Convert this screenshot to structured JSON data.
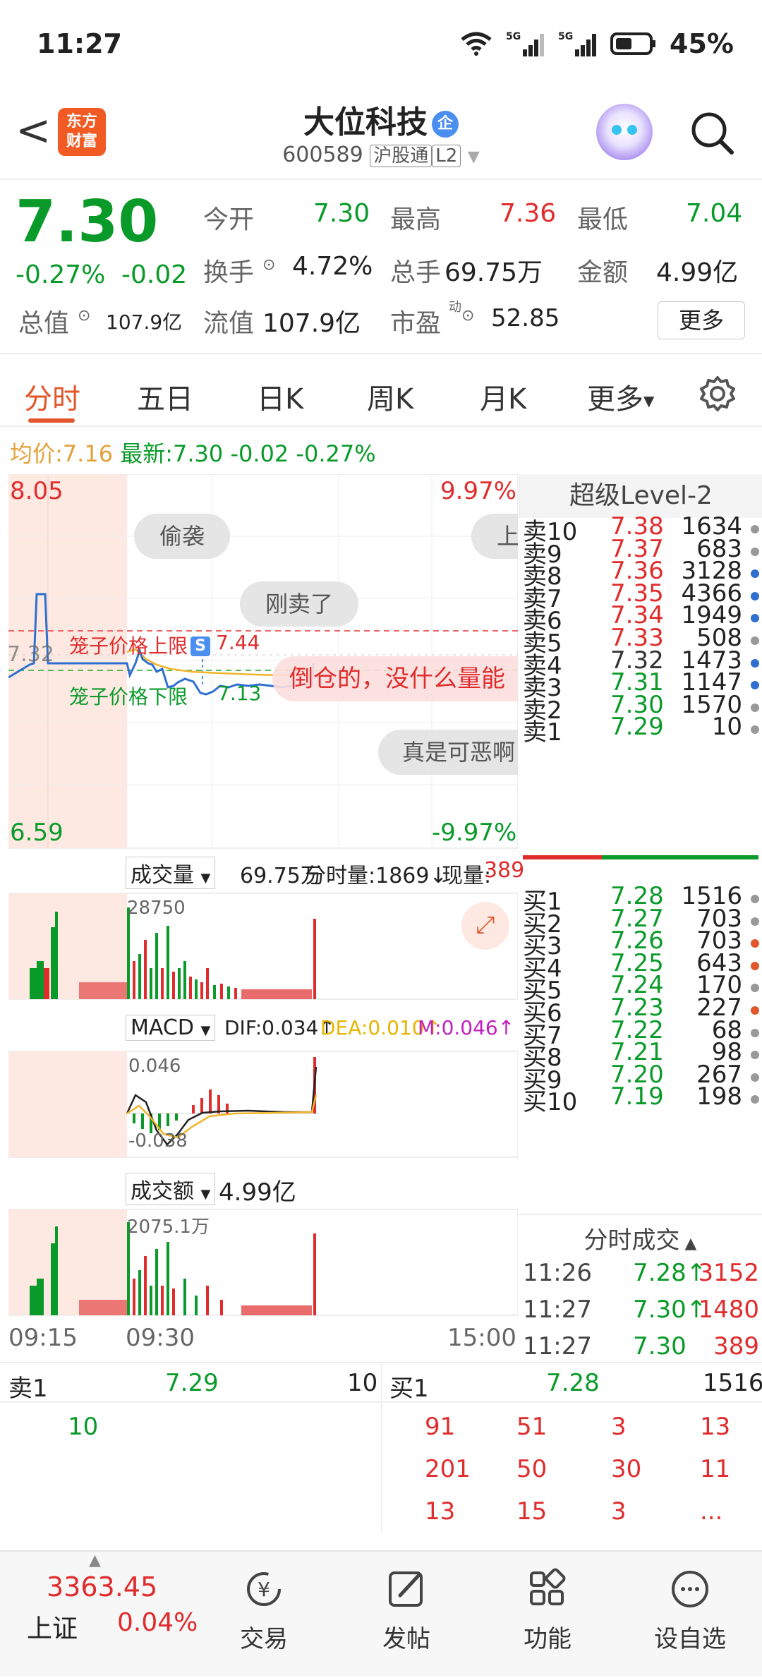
{
  "status": {
    "time": "11:27",
    "battery": "45%",
    "net1": "5G",
    "net2": "5G"
  },
  "header": {
    "back": "<",
    "logo_line1": "东方",
    "logo_line2": "财富",
    "stock_name": "大位科技",
    "badge": "企",
    "code": "600589",
    "market": "沪股通",
    "level": "L2"
  },
  "quote": {
    "price": "7.30",
    "change_pct": "-0.27%",
    "change": "-0.02",
    "open_label": "今开",
    "open": "7.30",
    "high_label": "最高",
    "high": "7.36",
    "low_label": "最低",
    "low": "7.04",
    "turnover_label": "换手",
    "turnover": "4.72%",
    "volume_label": "总手",
    "volume": "69.75万",
    "amount_label": "金额",
    "amount": "4.99亿",
    "mktcap_label": "总值",
    "mktcap": "107.9亿",
    "float_label": "流值",
    "float": "107.9亿",
    "pe_label": "市盈",
    "pe_sup": "动",
    "pe": "52.85",
    "more": "更多"
  },
  "tabs": [
    "分时",
    "五日",
    "日K",
    "周K",
    "月K",
    "更多"
  ],
  "avg": {
    "avg_label": "均价:",
    "avg": "7.16",
    "latest_label": "最新:",
    "latest": "7.30",
    "chg": "-0.02",
    "pct": "-0.27%"
  },
  "chart": {
    "top_price": "8.05",
    "top_pct": "9.97%",
    "bottom_price": "6.59",
    "bottom_pct": "-9.97%",
    "ref_price": "7.32",
    "cage_upper_label": "笼子价格上限",
    "cage_upper": "7.44",
    "cage_lower_label": "笼子价格下限",
    "cage_lower": "7.13",
    "s_marker": "S",
    "vol_sel": "成交量",
    "vol_total": "69.75万",
    "vol_min_label": "分时量:1869↓",
    "vol_now_label": "现量:",
    "vol_now": "389",
    "vol_max": "28750",
    "macd_sel": "MACD",
    "dif": "DIF:0.034↑",
    "dea": "DEA:0.010↑",
    "m": "M:0.046↑",
    "macd_max": "0.046",
    "macd_min": "-0.038",
    "amt_sel": "成交额",
    "amt_total": "4.99亿",
    "amt_max": "2075.1万",
    "t_start": "09:15",
    "t_open": "09:30",
    "t_end": "15:00"
  },
  "comments": [
    "偷袭",
    "上",
    "刚卖了",
    "倒仓的，没什么量能",
    "真是可恶啊"
  ],
  "level2_title": "超级Level-2",
  "asks": [
    {
      "name": "卖10",
      "price": "7.38",
      "vol": "1634",
      "dot": "#999999",
      "color": "red"
    },
    {
      "name": "卖9",
      "price": "7.37",
      "vol": "683",
      "dot": "#999999",
      "color": "red"
    },
    {
      "name": "卖8",
      "price": "7.36",
      "vol": "3128",
      "dot": "#2f6fd0",
      "color": "red"
    },
    {
      "name": "卖7",
      "price": "7.35",
      "vol": "4366",
      "dot": "#2f6fd0",
      "color": "red"
    },
    {
      "name": "卖6",
      "price": "7.34",
      "vol": "1949",
      "dot": "#2f6fd0",
      "color": "red"
    },
    {
      "name": "卖5",
      "price": "7.33",
      "vol": "508",
      "dot": "#999999",
      "color": "red"
    },
    {
      "name": "卖4",
      "price": "7.32",
      "vol": "1473",
      "dot": "#2f6fd0",
      "color": "gray"
    },
    {
      "name": "卖3",
      "price": "7.31",
      "vol": "1147",
      "dot": "#2f6fd0",
      "color": "green"
    },
    {
      "name": "卖2",
      "price": "7.30",
      "vol": "1570",
      "dot": "#999999",
      "color": "green"
    },
    {
      "name": "卖1",
      "price": "7.29",
      "vol": "10",
      "dot": "#999999",
      "color": "green"
    }
  ],
  "bids": [
    {
      "name": "买1",
      "price": "7.28",
      "vol": "1516",
      "dot": "#999999",
      "color": "green"
    },
    {
      "name": "买2",
      "price": "7.27",
      "vol": "703",
      "dot": "#999999",
      "color": "green"
    },
    {
      "name": "买3",
      "price": "7.26",
      "vol": "703",
      "dot": "#e2562a",
      "color": "green"
    },
    {
      "name": "买4",
      "price": "7.25",
      "vol": "643",
      "dot": "#e2562a",
      "color": "green"
    },
    {
      "name": "买5",
      "price": "7.24",
      "vol": "170",
      "dot": "#999999",
      "color": "green"
    },
    {
      "name": "买6",
      "price": "7.23",
      "vol": "227",
      "dot": "#e2562a",
      "color": "green"
    },
    {
      "name": "买7",
      "price": "7.22",
      "vol": "68",
      "dot": "#999999",
      "color": "green"
    },
    {
      "name": "买8",
      "price": "7.21",
      "vol": "98",
      "dot": "#999999",
      "color": "green"
    },
    {
      "name": "买9",
      "price": "7.20",
      "vol": "267",
      "dot": "#999999",
      "color": "green"
    },
    {
      "name": "买10",
      "price": "7.19",
      "vol": "198",
      "dot": "#999999",
      "color": "green"
    }
  ],
  "trades_title": "分时成交",
  "trades": [
    {
      "time": "11:26",
      "price": "7.28↑",
      "vol": "3152",
      "pcolor": "green",
      "vcolor": "red"
    },
    {
      "time": "11:27",
      "price": "7.30↑",
      "vol": "1480",
      "pcolor": "green",
      "vcolor": "red"
    },
    {
      "time": "11:27",
      "price": "7.30",
      "vol": "389",
      "pcolor": "green",
      "vcolor": "red"
    }
  ],
  "ladder": {
    "ask_label": "卖1",
    "ask_price": "7.29",
    "ask_vol": "10",
    "ask_queue": [
      "10"
    ],
    "bid_label": "买1",
    "bid_price": "7.28",
    "bid_vol": "1516",
    "bid_queue": [
      [
        "91",
        "51",
        "3",
        "13"
      ],
      [
        "201",
        "50",
        "30",
        "11"
      ],
      [
        "13",
        "15",
        "3",
        "..."
      ]
    ]
  },
  "nav": {
    "index_value": "3363.45",
    "index_name": "上证",
    "index_pct": "0.04%",
    "items": [
      "交易",
      "发帖",
      "功能",
      "设自选"
    ]
  },
  "colors": {
    "red": "#e02c2c",
    "green": "#0a9a2a",
    "accent": "#e2562a"
  }
}
